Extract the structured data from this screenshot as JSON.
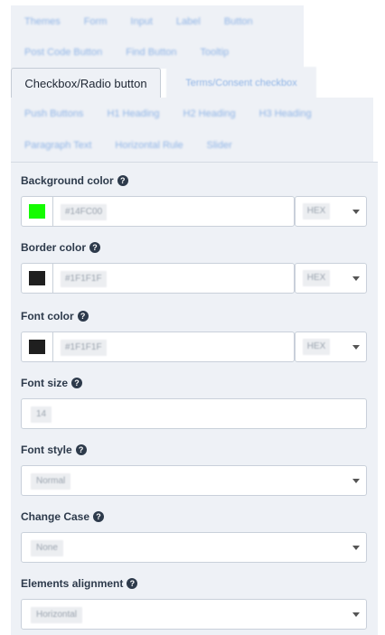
{
  "tabs_row1": [
    "Themes",
    "Form",
    "Input",
    "Label",
    "Button"
  ],
  "tabs_row2": [
    "Post Code Button",
    "Find Button",
    "Tooltip"
  ],
  "active_tab": "Checkbox/Radio button",
  "terms_tab": "Terms/Consent checkbox",
  "tabs_row4": [
    "Push Buttons",
    "H1 Heading",
    "H2 Heading",
    "H3 Heading"
  ],
  "tabs_row5": [
    "Paragraph Text",
    "Horizontal Rule",
    "Slider"
  ],
  "fields": {
    "background_color": {
      "label": "Background color",
      "value": "#14FC00",
      "swatch": "#14FC00",
      "format": "HEX"
    },
    "border_color": {
      "label": "Border color",
      "value": "#1F1F1F",
      "swatch": "#1F1F1F",
      "format": "HEX"
    },
    "font_color": {
      "label": "Font color",
      "value": "#1F1F1F",
      "swatch": "#1F1F1F",
      "format": "HEX"
    },
    "font_size": {
      "label": "Font size",
      "value": "14"
    },
    "font_style": {
      "label": "Font style",
      "value": "Normal"
    },
    "change_case": {
      "label": "Change Case",
      "value": "None"
    },
    "elements_alignment": {
      "label": "Elements alignment",
      "value": "Horizontal"
    }
  },
  "help_icon_glyph": "?",
  "colors": {
    "panel_bg": "#eef1f6",
    "tab_link": "#8fb4e6",
    "label_text": "#2d3a4b"
  }
}
